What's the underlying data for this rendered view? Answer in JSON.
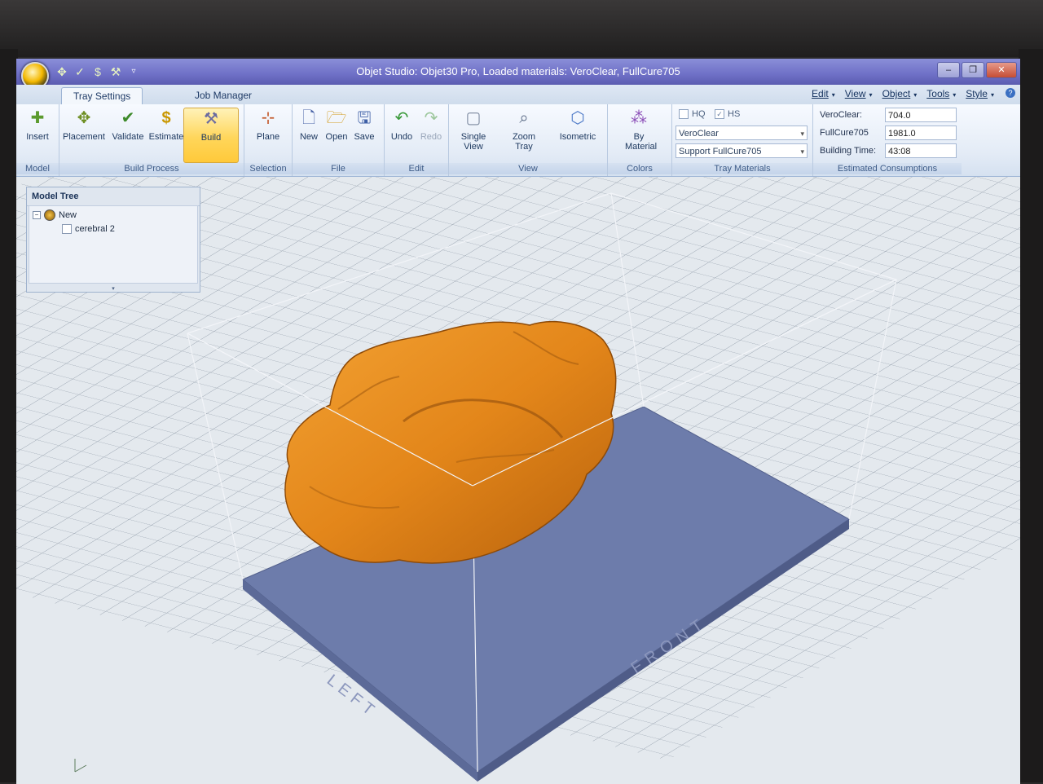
{
  "window": {
    "title": "Objet Studio: Objet30 Pro,     Loaded materials: VeroClear, FullCure705",
    "controls": [
      "minimize",
      "maximize",
      "close"
    ]
  },
  "quick_access": [
    "placement-icon",
    "validate-icon",
    "estimate-icon",
    "build-icon"
  ],
  "tabs": [
    {
      "label": "Tray Settings",
      "active": true
    },
    {
      "label": "Job Manager",
      "active": false
    }
  ],
  "menu": [
    "Edit",
    "View",
    "Object",
    "Tools",
    "Style"
  ],
  "ribbon": {
    "model": {
      "label": "Model",
      "insert": "Insert"
    },
    "build_process": {
      "label": "Build Process",
      "placement": "Placement",
      "validate": "Validate",
      "estimate": "Estimate",
      "build": "Build"
    },
    "selection": {
      "label": "Selection",
      "plane": "Plane"
    },
    "file": {
      "label": "File",
      "new": "New",
      "open": "Open",
      "save": "Save"
    },
    "edit": {
      "label": "Edit",
      "undo": "Undo",
      "redo": "Redo"
    },
    "view": {
      "label": "View",
      "single_view": "Single View",
      "zoom_tray": "Zoom Tray",
      "isometric": "Isometric"
    },
    "colors": {
      "label": "Colors",
      "by_material": "By Material"
    },
    "tray_materials": {
      "label": "Tray Materials",
      "hq": "HQ",
      "hs": "HS",
      "hq_checked": false,
      "hs_checked": true,
      "model_material": "VeroClear",
      "support_material": "Support FullCure705"
    },
    "estimated": {
      "label": "Estimated Consumptions",
      "rows": [
        {
          "label": "VeroClear:",
          "value": "704.0"
        },
        {
          "label": "FullCure705",
          "value": "1981.0"
        },
        {
          "label": "Building Time:",
          "value": "43:08"
        }
      ]
    }
  },
  "model_tree": {
    "title": "Model Tree",
    "root": "New",
    "child": "cerebral 2"
  },
  "tray_labels": {
    "left": "LEFT",
    "front": "FRONT"
  },
  "colors": {
    "model": "#e98a1a",
    "tray": "#6878a8",
    "grid": "#8b96a4"
  }
}
